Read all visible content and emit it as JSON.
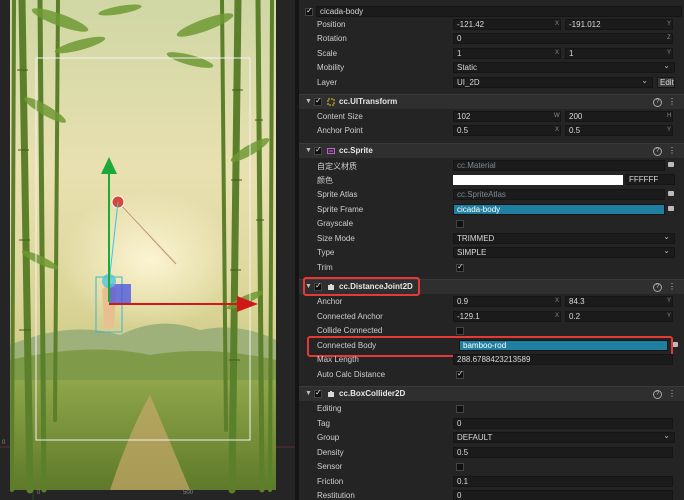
{
  "node_name": "cicada-body",
  "transform": {
    "position": {
      "label": "Position",
      "x": "-121.42",
      "y": "-191.012"
    },
    "rotation": {
      "label": "Rotation",
      "value": "0"
    },
    "scale": {
      "label": "Scale",
      "x": "1",
      "y": "1"
    },
    "mobility": {
      "label": "Mobility",
      "value": "Static"
    },
    "layer": {
      "label": "Layer",
      "value": "UI_2D",
      "edit": "Edit"
    }
  },
  "ui_transform": {
    "title": "cc.UITransform",
    "content_size": {
      "label": "Content Size",
      "w": "102",
      "h": "200"
    },
    "anchor_point": {
      "label": "Anchor Point",
      "x": "0.5",
      "y": "0.5"
    }
  },
  "sprite": {
    "title": "cc.Sprite",
    "custom_material": {
      "label": "自定义材质",
      "value": "cc.Material"
    },
    "color": {
      "label": "颜色",
      "hex": "FFFFFF"
    },
    "sprite_atlas": {
      "label": "Sprite Atlas",
      "value": "cc.SpriteAtlas"
    },
    "sprite_frame": {
      "label": "Sprite Frame",
      "value": "cicada-body"
    },
    "grayscale": {
      "label": "Grayscale",
      "checked": false
    },
    "size_mode": {
      "label": "Size Mode",
      "value": "TRIMMED"
    },
    "type": {
      "label": "Type",
      "value": "SIMPLE"
    },
    "trim": {
      "label": "Trim",
      "checked": true
    }
  },
  "distance_joint": {
    "title": "cc.DistanceJoint2D",
    "anchor": {
      "label": "Anchor",
      "x": "0.9",
      "y": "84.3"
    },
    "connected_anchor": {
      "label": "Connected Anchor",
      "x": "-129.1",
      "y": "0.2"
    },
    "collide_connected": {
      "label": "Collide Connected",
      "checked": false
    },
    "connected_body": {
      "label": "Connected Body",
      "value": "bamboo-rod"
    },
    "max_length": {
      "label": "Max Length",
      "value": "288.6788423213589"
    },
    "auto_calc": {
      "label": "Auto Calc Distance",
      "checked": true
    }
  },
  "box_collider": {
    "title": "cc.BoxCollider2D",
    "editing": {
      "label": "Editing",
      "checked": false
    },
    "tag": {
      "label": "Tag",
      "value": "0"
    },
    "group": {
      "label": "Group",
      "value": "DEFAULT"
    },
    "density": {
      "label": "Density",
      "value": "0.5"
    },
    "sensor": {
      "label": "Sensor",
      "checked": false
    },
    "friction": {
      "label": "Friction",
      "value": "0.1"
    },
    "restitution": {
      "label": "Restitution",
      "value": "0"
    }
  },
  "scene": {
    "ruler_left": "0",
    "ruler_bottom": "0",
    "ruler_mid": "500"
  },
  "colors": {
    "accent_blue": "#1e7fa0",
    "highlight_red": "#e53935",
    "gizmo_green": "#1ea83a",
    "gizmo_red": "#d01818"
  }
}
